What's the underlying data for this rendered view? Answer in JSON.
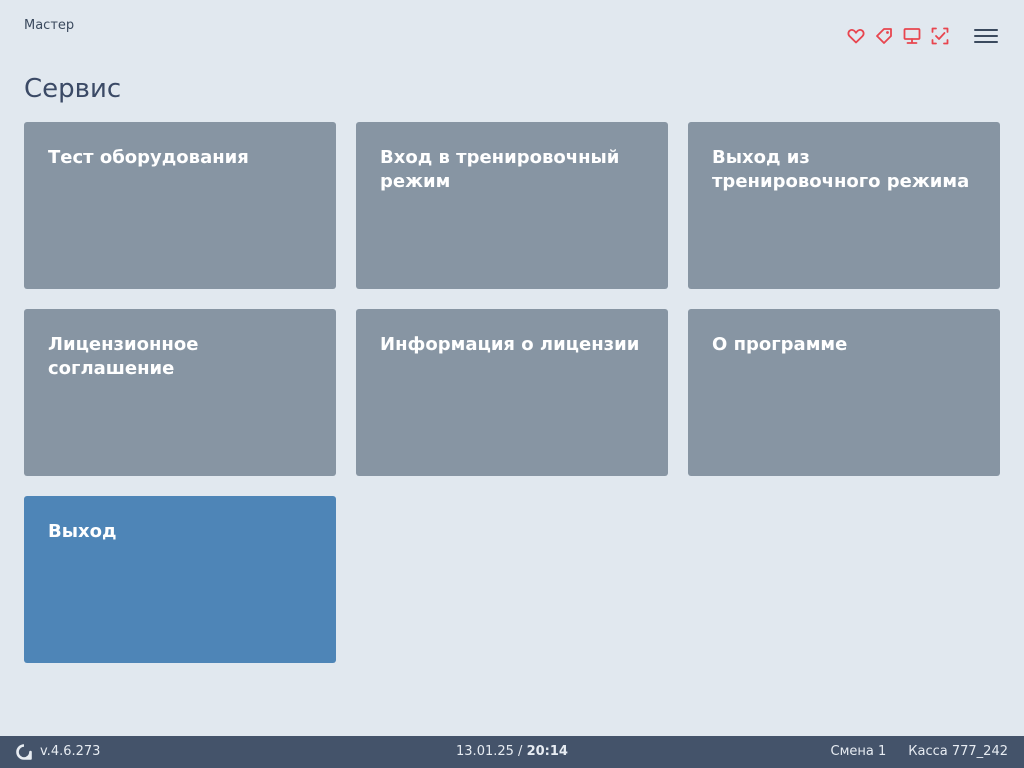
{
  "header": {
    "user": "Мастер",
    "status_icons": [
      "heart-icon",
      "tag-icon",
      "monitor-icon",
      "checklist-icon"
    ],
    "menu_icon": "hamburger-menu-icon",
    "accent_color": "#e8454f"
  },
  "page": {
    "title": "Сервис"
  },
  "tiles": [
    {
      "label": "Тест оборудования"
    },
    {
      "label": "Вход в тренировочный режим"
    },
    {
      "label": "Выход из тренировочного режима"
    },
    {
      "label": "Лицензионное соглашение"
    },
    {
      "label": "Информация о лицензии"
    },
    {
      "label": "О программе"
    },
    {
      "label": "Выход"
    }
  ],
  "colors": {
    "background": "#e1e8ef",
    "tile": "#8795a3",
    "tile_primary": "#4e85b7",
    "footer": "#44536a"
  },
  "footer": {
    "logo": "app-logo-icon",
    "version": "v.4.6.273",
    "date": "13.01.25",
    "separator": "/",
    "time": "20:14",
    "shift": "Смена 1",
    "register": "Касса 777_242"
  }
}
